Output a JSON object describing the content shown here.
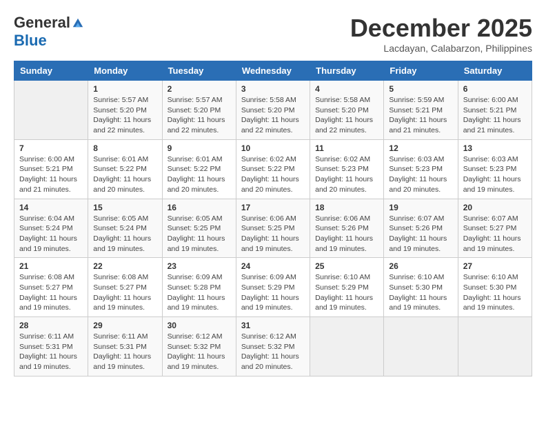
{
  "header": {
    "logo_general": "General",
    "logo_blue": "Blue",
    "month_title": "December 2025",
    "location": "Lacdayan, Calabarzon, Philippines"
  },
  "weekdays": [
    "Sunday",
    "Monday",
    "Tuesday",
    "Wednesday",
    "Thursday",
    "Friday",
    "Saturday"
  ],
  "weeks": [
    [
      {
        "day": "",
        "info": ""
      },
      {
        "day": "1",
        "info": "Sunrise: 5:57 AM\nSunset: 5:20 PM\nDaylight: 11 hours\nand 22 minutes."
      },
      {
        "day": "2",
        "info": "Sunrise: 5:57 AM\nSunset: 5:20 PM\nDaylight: 11 hours\nand 22 minutes."
      },
      {
        "day": "3",
        "info": "Sunrise: 5:58 AM\nSunset: 5:20 PM\nDaylight: 11 hours\nand 22 minutes."
      },
      {
        "day": "4",
        "info": "Sunrise: 5:58 AM\nSunset: 5:20 PM\nDaylight: 11 hours\nand 22 minutes."
      },
      {
        "day": "5",
        "info": "Sunrise: 5:59 AM\nSunset: 5:21 PM\nDaylight: 11 hours\nand 21 minutes."
      },
      {
        "day": "6",
        "info": "Sunrise: 6:00 AM\nSunset: 5:21 PM\nDaylight: 11 hours\nand 21 minutes."
      }
    ],
    [
      {
        "day": "7",
        "info": "Sunrise: 6:00 AM\nSunset: 5:21 PM\nDaylight: 11 hours\nand 21 minutes."
      },
      {
        "day": "8",
        "info": "Sunrise: 6:01 AM\nSunset: 5:22 PM\nDaylight: 11 hours\nand 20 minutes."
      },
      {
        "day": "9",
        "info": "Sunrise: 6:01 AM\nSunset: 5:22 PM\nDaylight: 11 hours\nand 20 minutes."
      },
      {
        "day": "10",
        "info": "Sunrise: 6:02 AM\nSunset: 5:22 PM\nDaylight: 11 hours\nand 20 minutes."
      },
      {
        "day": "11",
        "info": "Sunrise: 6:02 AM\nSunset: 5:23 PM\nDaylight: 11 hours\nand 20 minutes."
      },
      {
        "day": "12",
        "info": "Sunrise: 6:03 AM\nSunset: 5:23 PM\nDaylight: 11 hours\nand 20 minutes."
      },
      {
        "day": "13",
        "info": "Sunrise: 6:03 AM\nSunset: 5:23 PM\nDaylight: 11 hours\nand 19 minutes."
      }
    ],
    [
      {
        "day": "14",
        "info": "Sunrise: 6:04 AM\nSunset: 5:24 PM\nDaylight: 11 hours\nand 19 minutes."
      },
      {
        "day": "15",
        "info": "Sunrise: 6:05 AM\nSunset: 5:24 PM\nDaylight: 11 hours\nand 19 minutes."
      },
      {
        "day": "16",
        "info": "Sunrise: 6:05 AM\nSunset: 5:25 PM\nDaylight: 11 hours\nand 19 minutes."
      },
      {
        "day": "17",
        "info": "Sunrise: 6:06 AM\nSunset: 5:25 PM\nDaylight: 11 hours\nand 19 minutes."
      },
      {
        "day": "18",
        "info": "Sunrise: 6:06 AM\nSunset: 5:26 PM\nDaylight: 11 hours\nand 19 minutes."
      },
      {
        "day": "19",
        "info": "Sunrise: 6:07 AM\nSunset: 5:26 PM\nDaylight: 11 hours\nand 19 minutes."
      },
      {
        "day": "20",
        "info": "Sunrise: 6:07 AM\nSunset: 5:27 PM\nDaylight: 11 hours\nand 19 minutes."
      }
    ],
    [
      {
        "day": "21",
        "info": "Sunrise: 6:08 AM\nSunset: 5:27 PM\nDaylight: 11 hours\nand 19 minutes."
      },
      {
        "day": "22",
        "info": "Sunrise: 6:08 AM\nSunset: 5:27 PM\nDaylight: 11 hours\nand 19 minutes."
      },
      {
        "day": "23",
        "info": "Sunrise: 6:09 AM\nSunset: 5:28 PM\nDaylight: 11 hours\nand 19 minutes."
      },
      {
        "day": "24",
        "info": "Sunrise: 6:09 AM\nSunset: 5:29 PM\nDaylight: 11 hours\nand 19 minutes."
      },
      {
        "day": "25",
        "info": "Sunrise: 6:10 AM\nSunset: 5:29 PM\nDaylight: 11 hours\nand 19 minutes."
      },
      {
        "day": "26",
        "info": "Sunrise: 6:10 AM\nSunset: 5:30 PM\nDaylight: 11 hours\nand 19 minutes."
      },
      {
        "day": "27",
        "info": "Sunrise: 6:10 AM\nSunset: 5:30 PM\nDaylight: 11 hours\nand 19 minutes."
      }
    ],
    [
      {
        "day": "28",
        "info": "Sunrise: 6:11 AM\nSunset: 5:31 PM\nDaylight: 11 hours\nand 19 minutes."
      },
      {
        "day": "29",
        "info": "Sunrise: 6:11 AM\nSunset: 5:31 PM\nDaylight: 11 hours\nand 19 minutes."
      },
      {
        "day": "30",
        "info": "Sunrise: 6:12 AM\nSunset: 5:32 PM\nDaylight: 11 hours\nand 19 minutes."
      },
      {
        "day": "31",
        "info": "Sunrise: 6:12 AM\nSunset: 5:32 PM\nDaylight: 11 hours\nand 20 minutes."
      },
      {
        "day": "",
        "info": ""
      },
      {
        "day": "",
        "info": ""
      },
      {
        "day": "",
        "info": ""
      }
    ]
  ]
}
